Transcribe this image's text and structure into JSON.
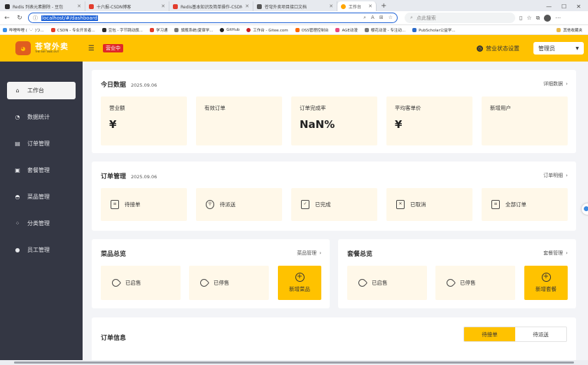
{
  "browser": {
    "tabs": [
      {
        "title": "Redis 列表元素删除 - 豆包",
        "color": "#2b2b2b"
      },
      {
        "title": "十六报-CSDN博客",
        "color": "#e23d2d"
      },
      {
        "title": "Redis基本知识及简单操作-CSDN",
        "color": "#e23d2d"
      },
      {
        "title": "苍穹外卖项目接口文档",
        "color": "#555555"
      },
      {
        "title": "工作台",
        "color": "#ffa500"
      }
    ],
    "url": "localhost/#/dashboard",
    "search_placeholder": "点此搜索",
    "bookmarks": [
      "哔哩哔哩 ( ˙-˙ )つ...",
      "CSDN - 专业开发者...",
      "豆包 - 字节跳动旗...",
      "学习通",
      "旗舰系统(夏宿学...",
      "GitHub",
      "工作台 - Gitee.com",
      "OSS管理控制台",
      "AGE动漫",
      "樱花动漫 - 专注动...",
      "PubScholar公益学..."
    ],
    "bookmarks_folder": "其他收藏夹"
  },
  "header": {
    "logo_cn": "苍穹外卖",
    "logo_en": "THE SKY TAKE-OUT",
    "status_badge": "营业中",
    "shop_setting": "营业状态设置",
    "user": "管理员"
  },
  "sidebar": {
    "items": [
      {
        "label": "工作台",
        "icon": "home-icon"
      },
      {
        "label": "数据统计",
        "icon": "chart-icon"
      },
      {
        "label": "订单管理",
        "icon": "order-icon"
      },
      {
        "label": "套餐管理",
        "icon": "gift-icon"
      },
      {
        "label": "菜品管理",
        "icon": "dish-icon"
      },
      {
        "label": "分类管理",
        "icon": "category-icon"
      },
      {
        "label": "员工管理",
        "icon": "user-icon"
      }
    ]
  },
  "today": {
    "title": "今日数据",
    "date": "2025.09.06",
    "link": "详细数据",
    "stats": [
      {
        "label": "营业额",
        "value": "¥"
      },
      {
        "label": "有效订单",
        "value": ""
      },
      {
        "label": "订单完成率",
        "value": "NaN%"
      },
      {
        "label": "平均客单价",
        "value": "¥"
      },
      {
        "label": "新增用户",
        "value": ""
      }
    ]
  },
  "orders": {
    "title": "订单管理",
    "date": "2025.09.06",
    "link": "订单明细",
    "items": [
      "待接单",
      "待派送",
      "已完成",
      "已取消",
      "全部订单"
    ]
  },
  "dishes": {
    "title": "菜品总览",
    "link": "菜品管理",
    "on_sale": "已启售",
    "off_sale": "已停售",
    "add": "新增菜品"
  },
  "setmeals": {
    "title": "套餐总览",
    "link": "套餐管理",
    "on_sale": "已启售",
    "off_sale": "已停售",
    "add": "新增套餐"
  },
  "order_info": {
    "title": "订单信息",
    "tabs": [
      "待接单",
      "待派送"
    ]
  }
}
